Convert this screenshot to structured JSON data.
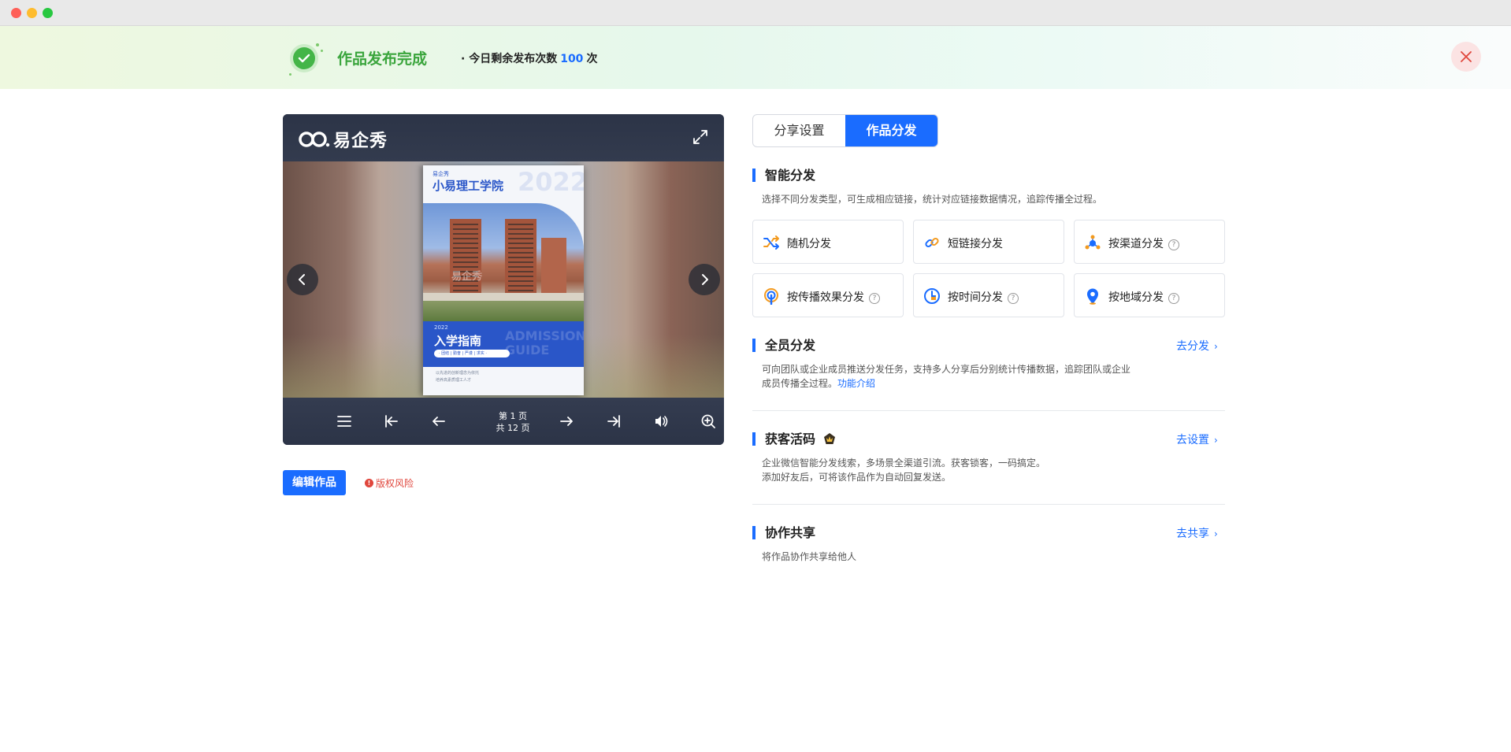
{
  "banner": {
    "title": "作品发布完成",
    "remaining_prefix": "· 今日剩余发布次数",
    "remaining_count": "100",
    "remaining_suffix": "次"
  },
  "viewer": {
    "logo_text": "易企秀",
    "page_line1": "第 1 页",
    "page_line2": "共 12 页",
    "cover": {
      "brand": "易企秀",
      "school": "小易理工学院",
      "year": "2022",
      "band_small": "2022",
      "band_title": "入学指南",
      "band_pill": "· 团结 | 勤奋 | 严谨 | 求实 ·",
      "band_en": "ADMISSION GUIDE",
      "foot_line1": "以先进的创新理念为依托",
      "foot_line2": "培养高素质理工人才"
    }
  },
  "actions": {
    "edit_label": "编辑作品",
    "risk_label": "版权风险"
  },
  "tabs": [
    {
      "label": "分享设置",
      "active": false
    },
    {
      "label": "作品分发",
      "active": true
    }
  ],
  "smart": {
    "title": "智能分发",
    "desc": "选择不同分发类型，可生成相应链接，统计对应链接数据情况，追踪传播全过程。",
    "cards": [
      {
        "label": "随机分发",
        "icon": "shuffle-icon",
        "help": false
      },
      {
        "label": "短链接分发",
        "icon": "link-icon",
        "help": false
      },
      {
        "label": "按渠道分发",
        "icon": "channel-icon",
        "help": true
      },
      {
        "label": "按传播效果分发",
        "icon": "broadcast-icon",
        "help": true
      },
      {
        "label": "按时间分发",
        "icon": "clock-icon",
        "help": true
      },
      {
        "label": "按地域分发",
        "icon": "location-icon",
        "help": true
      }
    ]
  },
  "staff": {
    "title": "全员分发",
    "link": "去分发",
    "desc_line1": "可向团队或企业成员推送分发任务，支持多人分享后分别统计传播数据，追踪团队或企业",
    "desc_line2": "成员传播全过程。",
    "desc_link": "功能介绍"
  },
  "qrcode": {
    "title": "获客活码",
    "link": "去设置",
    "desc_line1": "企业微信智能分发线索，多场景全渠道引流。获客锁客，一码搞定。",
    "desc_line2": "添加好友后，可将该作品作为自动回复发送。"
  },
  "collab": {
    "title": "协作共享",
    "link": "去共享",
    "desc": "将作品协作共享给他人"
  },
  "colors": {
    "accent": "#1a6cff",
    "success": "#3aa53c",
    "danger": "#e0463c"
  }
}
